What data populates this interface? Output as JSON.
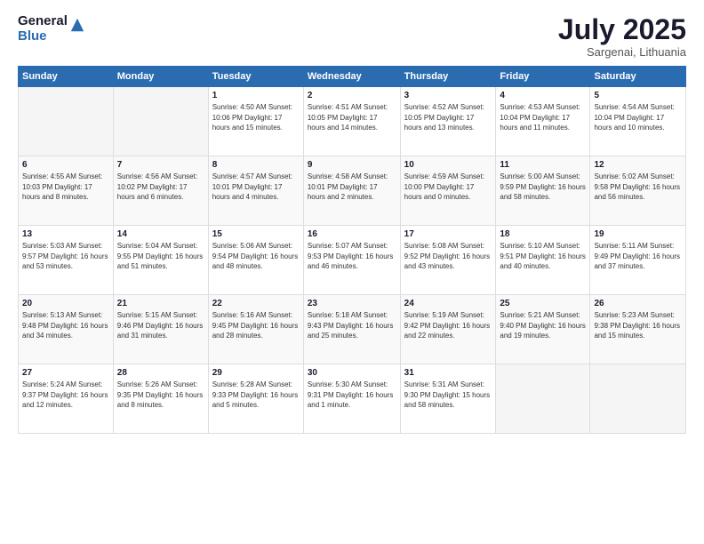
{
  "header": {
    "logo_general": "General",
    "logo_blue": "Blue",
    "month_year": "July 2025",
    "location": "Sargenai, Lithuania"
  },
  "weekdays": [
    "Sunday",
    "Monday",
    "Tuesday",
    "Wednesday",
    "Thursday",
    "Friday",
    "Saturday"
  ],
  "weeks": [
    [
      {
        "day": "",
        "detail": ""
      },
      {
        "day": "",
        "detail": ""
      },
      {
        "day": "1",
        "detail": "Sunrise: 4:50 AM\nSunset: 10:06 PM\nDaylight: 17 hours\nand 15 minutes."
      },
      {
        "day": "2",
        "detail": "Sunrise: 4:51 AM\nSunset: 10:05 PM\nDaylight: 17 hours\nand 14 minutes."
      },
      {
        "day": "3",
        "detail": "Sunrise: 4:52 AM\nSunset: 10:05 PM\nDaylight: 17 hours\nand 13 minutes."
      },
      {
        "day": "4",
        "detail": "Sunrise: 4:53 AM\nSunset: 10:04 PM\nDaylight: 17 hours\nand 11 minutes."
      },
      {
        "day": "5",
        "detail": "Sunrise: 4:54 AM\nSunset: 10:04 PM\nDaylight: 17 hours\nand 10 minutes."
      }
    ],
    [
      {
        "day": "6",
        "detail": "Sunrise: 4:55 AM\nSunset: 10:03 PM\nDaylight: 17 hours\nand 8 minutes."
      },
      {
        "day": "7",
        "detail": "Sunrise: 4:56 AM\nSunset: 10:02 PM\nDaylight: 17 hours\nand 6 minutes."
      },
      {
        "day": "8",
        "detail": "Sunrise: 4:57 AM\nSunset: 10:01 PM\nDaylight: 17 hours\nand 4 minutes."
      },
      {
        "day": "9",
        "detail": "Sunrise: 4:58 AM\nSunset: 10:01 PM\nDaylight: 17 hours\nand 2 minutes."
      },
      {
        "day": "10",
        "detail": "Sunrise: 4:59 AM\nSunset: 10:00 PM\nDaylight: 17 hours\nand 0 minutes."
      },
      {
        "day": "11",
        "detail": "Sunrise: 5:00 AM\nSunset: 9:59 PM\nDaylight: 16 hours\nand 58 minutes."
      },
      {
        "day": "12",
        "detail": "Sunrise: 5:02 AM\nSunset: 9:58 PM\nDaylight: 16 hours\nand 56 minutes."
      }
    ],
    [
      {
        "day": "13",
        "detail": "Sunrise: 5:03 AM\nSunset: 9:57 PM\nDaylight: 16 hours\nand 53 minutes."
      },
      {
        "day": "14",
        "detail": "Sunrise: 5:04 AM\nSunset: 9:55 PM\nDaylight: 16 hours\nand 51 minutes."
      },
      {
        "day": "15",
        "detail": "Sunrise: 5:06 AM\nSunset: 9:54 PM\nDaylight: 16 hours\nand 48 minutes."
      },
      {
        "day": "16",
        "detail": "Sunrise: 5:07 AM\nSunset: 9:53 PM\nDaylight: 16 hours\nand 46 minutes."
      },
      {
        "day": "17",
        "detail": "Sunrise: 5:08 AM\nSunset: 9:52 PM\nDaylight: 16 hours\nand 43 minutes."
      },
      {
        "day": "18",
        "detail": "Sunrise: 5:10 AM\nSunset: 9:51 PM\nDaylight: 16 hours\nand 40 minutes."
      },
      {
        "day": "19",
        "detail": "Sunrise: 5:11 AM\nSunset: 9:49 PM\nDaylight: 16 hours\nand 37 minutes."
      }
    ],
    [
      {
        "day": "20",
        "detail": "Sunrise: 5:13 AM\nSunset: 9:48 PM\nDaylight: 16 hours\nand 34 minutes."
      },
      {
        "day": "21",
        "detail": "Sunrise: 5:15 AM\nSunset: 9:46 PM\nDaylight: 16 hours\nand 31 minutes."
      },
      {
        "day": "22",
        "detail": "Sunrise: 5:16 AM\nSunset: 9:45 PM\nDaylight: 16 hours\nand 28 minutes."
      },
      {
        "day": "23",
        "detail": "Sunrise: 5:18 AM\nSunset: 9:43 PM\nDaylight: 16 hours\nand 25 minutes."
      },
      {
        "day": "24",
        "detail": "Sunrise: 5:19 AM\nSunset: 9:42 PM\nDaylight: 16 hours\nand 22 minutes."
      },
      {
        "day": "25",
        "detail": "Sunrise: 5:21 AM\nSunset: 9:40 PM\nDaylight: 16 hours\nand 19 minutes."
      },
      {
        "day": "26",
        "detail": "Sunrise: 5:23 AM\nSunset: 9:38 PM\nDaylight: 16 hours\nand 15 minutes."
      }
    ],
    [
      {
        "day": "27",
        "detail": "Sunrise: 5:24 AM\nSunset: 9:37 PM\nDaylight: 16 hours\nand 12 minutes."
      },
      {
        "day": "28",
        "detail": "Sunrise: 5:26 AM\nSunset: 9:35 PM\nDaylight: 16 hours\nand 8 minutes."
      },
      {
        "day": "29",
        "detail": "Sunrise: 5:28 AM\nSunset: 9:33 PM\nDaylight: 16 hours\nand 5 minutes."
      },
      {
        "day": "30",
        "detail": "Sunrise: 5:30 AM\nSunset: 9:31 PM\nDaylight: 16 hours\nand 1 minute."
      },
      {
        "day": "31",
        "detail": "Sunrise: 5:31 AM\nSunset: 9:30 PM\nDaylight: 15 hours\nand 58 minutes."
      },
      {
        "day": "",
        "detail": ""
      },
      {
        "day": "",
        "detail": ""
      }
    ]
  ]
}
